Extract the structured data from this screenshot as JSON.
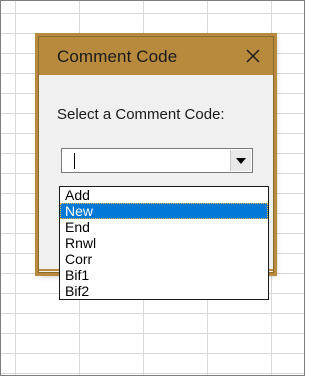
{
  "dialog": {
    "title": "Comment Code",
    "close_icon": "close-icon",
    "prompt": "Select a Comment Code:",
    "combo_value": "",
    "dropdown_icon": "dropdown-arrow-icon"
  },
  "dropdown": {
    "selected_index": 1,
    "options": [
      {
        "label": "Add"
      },
      {
        "label": "New"
      },
      {
        "label": "End"
      },
      {
        "label": "Rnwl"
      },
      {
        "label": "Corr"
      },
      {
        "label": "Bif1"
      },
      {
        "label": "Bif2"
      }
    ]
  },
  "colors": {
    "titlebar": "#b88a3e",
    "selection": "#0078d7"
  }
}
